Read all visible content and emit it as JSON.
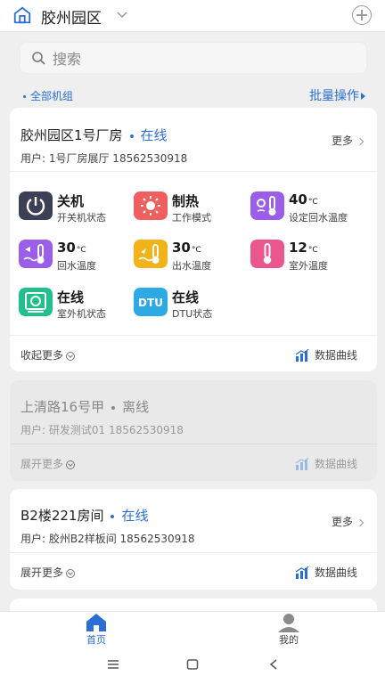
{
  "header": {
    "title": "胶州园区"
  },
  "search": {
    "placeholder": "搜索"
  },
  "groupbar": {
    "all_groups": "全部机组",
    "batch": "批量操作"
  },
  "devices": [
    {
      "name": "胶州园区1号厂房",
      "status": "在线",
      "user": "用户: 1号厂房展厅 18562530918",
      "more": "更多",
      "expanded": true,
      "metrics": [
        {
          "value": "关机",
          "unit": "",
          "label": "开关机状态",
          "icon": "power-icon",
          "color": "#3c3f55"
        },
        {
          "value": "制热",
          "unit": "",
          "label": "工作模式",
          "icon": "sun-icon",
          "color": "#ef5f5f"
        },
        {
          "value": "40",
          "unit": "°C",
          "label": "设定回水温度",
          "icon": "thermometer-settings-icon",
          "color": "#9a5ee8"
        },
        {
          "value": "30",
          "unit": "°C",
          "label": "回水温度",
          "icon": "return-water-icon",
          "color": "#9a5ee8"
        },
        {
          "value": "30",
          "unit": "°C",
          "label": "出水温度",
          "icon": "outlet-water-icon",
          "color": "#f2b21a"
        },
        {
          "value": "12",
          "unit": "°C",
          "label": "室外温度",
          "icon": "outdoor-thermometer-icon",
          "color": "#e9578c"
        },
        {
          "value": "在线",
          "unit": "",
          "label": "室外机状态",
          "icon": "outdoor-unit-icon",
          "color": "#21c08a"
        },
        {
          "value": "在线",
          "unit": "",
          "label": "DTU状态",
          "icon": "dtu-icon",
          "color": "#2fa8e6",
          "badge": "DTU"
        }
      ],
      "toggle": "收起更多",
      "chart_link": "数据曲线"
    },
    {
      "name": "上清路16号甲",
      "status": "离线",
      "user": "用户: 研发测试01 18562530918",
      "expanded": false,
      "toggle": "展开更多",
      "chart_link": "数据曲线"
    },
    {
      "name": "B2楼221房间",
      "status": "在线",
      "user": "用户: 胶州B2样板间 18562530918",
      "more": "更多",
      "expanded": false,
      "toggle": "展开更多",
      "chart_link": "数据曲线"
    }
  ],
  "tabs": [
    {
      "label": "首页",
      "icon": "home-icon",
      "active": true
    },
    {
      "label": "我的",
      "icon": "user-icon",
      "active": false
    }
  ],
  "colors": {
    "accent": "#2a6fd6"
  }
}
